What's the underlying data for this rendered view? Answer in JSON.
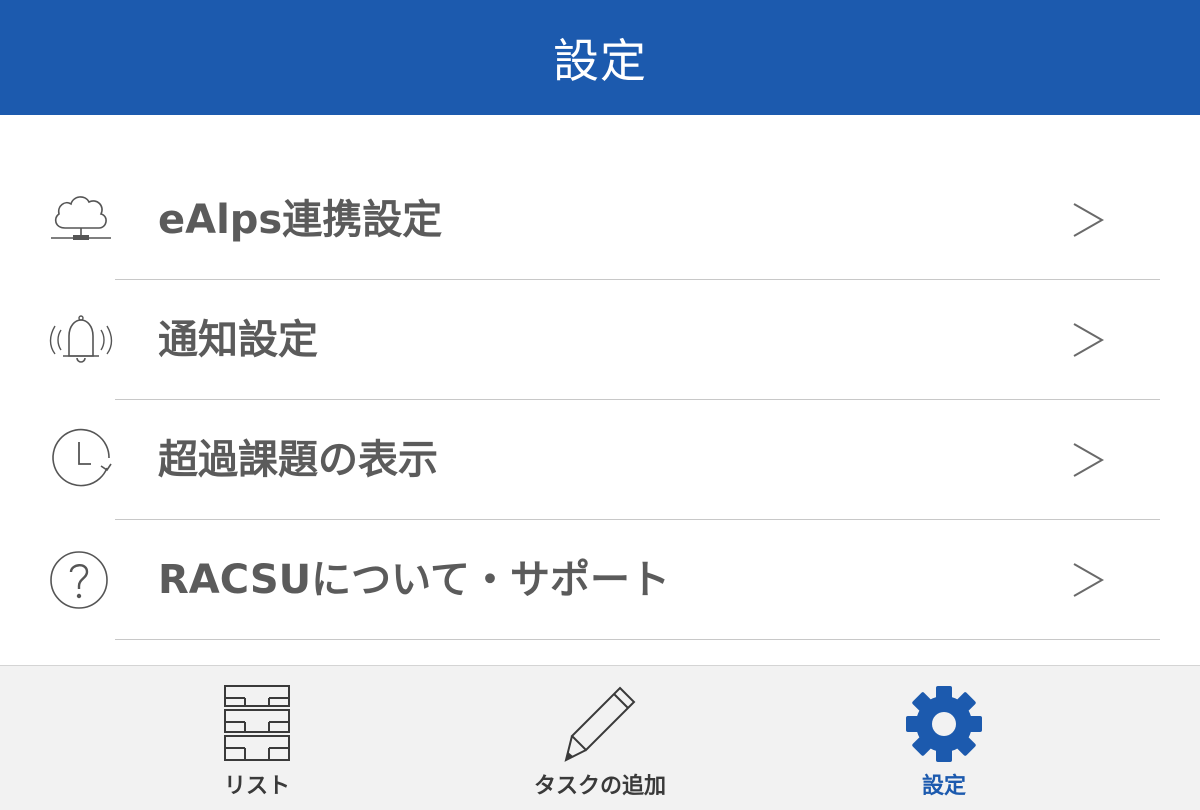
{
  "header": {
    "title": "設定",
    "background": "#1c5aae"
  },
  "menu": {
    "items": [
      {
        "label": "eAlps連携設定",
        "icon": "cloud-network-icon"
      },
      {
        "label": "通知設定",
        "icon": "ringing-bell-icon"
      },
      {
        "label": "超過課題の表示",
        "icon": "clock-refresh-icon"
      },
      {
        "label": "RACSUについて・サポート",
        "icon": "question-circle-icon"
      }
    ],
    "chevron": "chevron-right-icon"
  },
  "tabbar": {
    "tabs": [
      {
        "label": "リスト",
        "icon": "drawer-list-icon",
        "active": false
      },
      {
        "label": "タスクの追加",
        "icon": "pencil-icon",
        "active": false
      },
      {
        "label": "設定",
        "icon": "gear-icon",
        "active": true
      }
    ],
    "active_color": "#1c5aae"
  }
}
